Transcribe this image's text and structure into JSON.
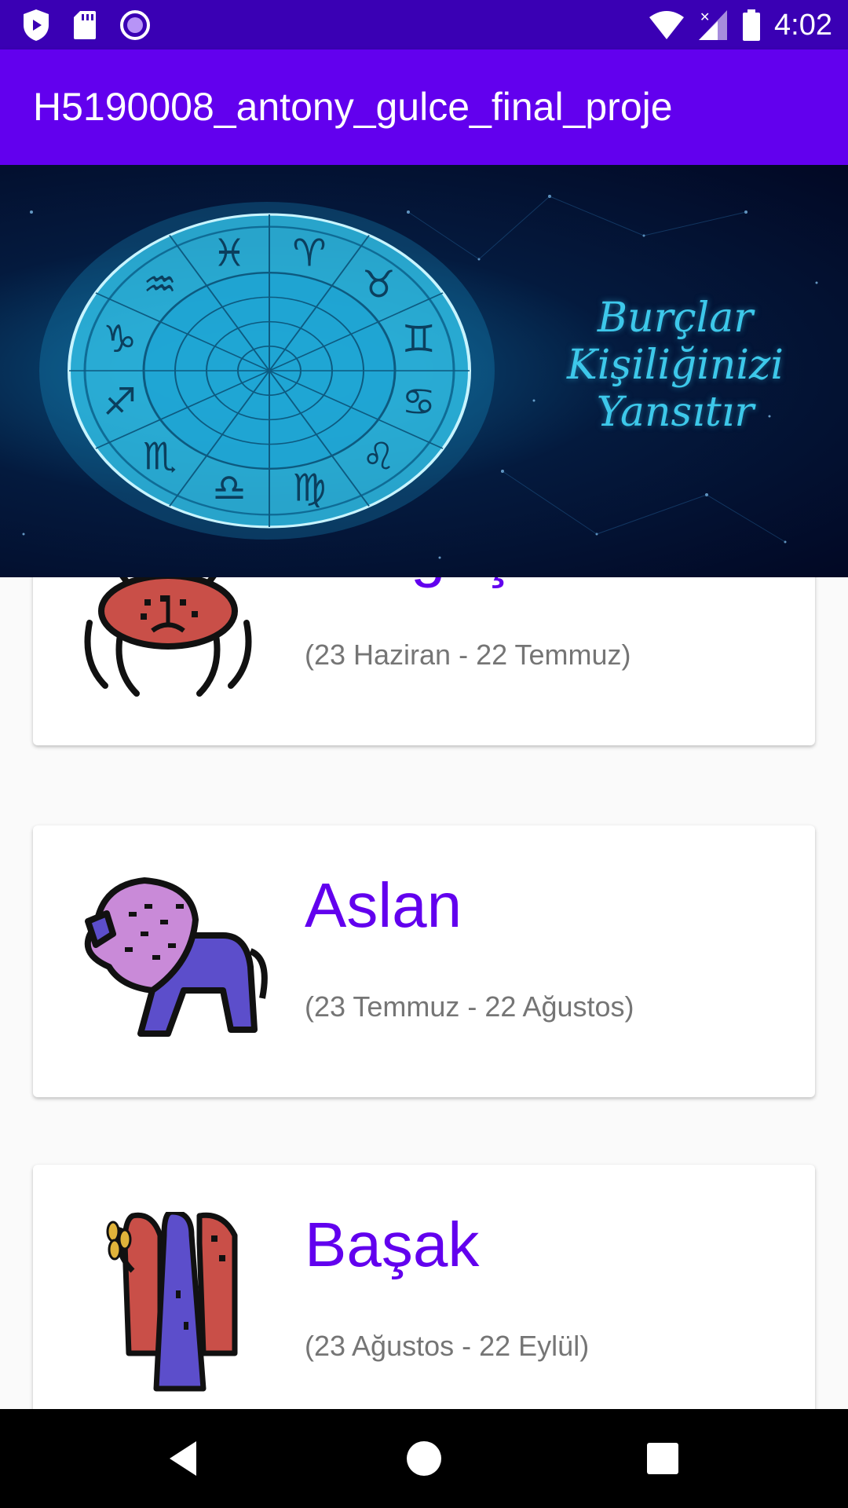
{
  "status_bar": {
    "time": "4:02",
    "left_icons": [
      "shield-play-icon",
      "sd-card-icon",
      "record-icon"
    ],
    "right_icons": [
      "wifi-icon",
      "cell-signal-icon",
      "battery-icon"
    ]
  },
  "app_bar": {
    "title": "H5190008_antony_gulce_final_proje"
  },
  "banner": {
    "line1": "Burçlar",
    "line2": "Kişiliğinizi",
    "line3": "Yansıtır",
    "zodiac_glyphs": [
      "♈",
      "♉",
      "♊",
      "♋",
      "♌",
      "♍",
      "♎",
      "♏",
      "♐",
      "♑",
      "♒",
      "♓"
    ]
  },
  "signs": [
    {
      "name": "Yengeç",
      "dates": "(23 Haziran - 22 Temmuz)",
      "icon": "crab-icon"
    },
    {
      "name": "Aslan",
      "dates": "(23 Temmuz - 22 Ağustos)",
      "icon": "lion-icon"
    },
    {
      "name": "Başak",
      "dates": "(23 Ağustos - 22 Eylül)",
      "icon": "virgo-icon"
    }
  ],
  "nav": [
    "back-icon",
    "home-icon",
    "recents-icon"
  ],
  "colors": {
    "status_bar": "#3a00b4",
    "primary": "#6200ee",
    "date_text": "#757575"
  }
}
